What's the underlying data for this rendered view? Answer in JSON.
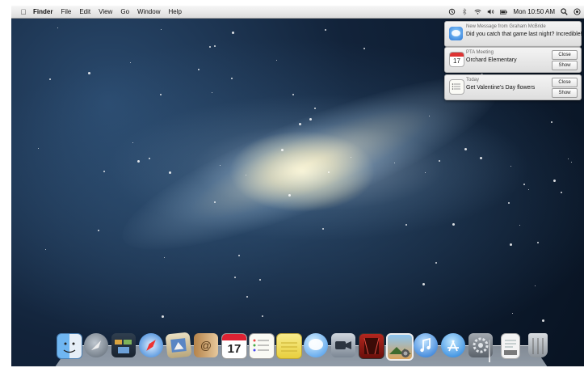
{
  "menubar": {
    "apple_glyph": "",
    "app_name": "Finder",
    "menus": [
      "File",
      "Edit",
      "View",
      "Go",
      "Window",
      "Help"
    ],
    "clock": "Mon 10:50 AM"
  },
  "notifications": [
    {
      "title": "New Message from Graham McBride",
      "body": "Did you catch that game last night? Incredible!",
      "icon": "messages-icon"
    },
    {
      "title": "PTA Meeting",
      "body": "Orchard Elementary",
      "icon": "calendar-icon",
      "calendar_day": "17",
      "buttons": [
        "Close",
        "Show"
      ]
    },
    {
      "title": "Today",
      "body": "Get Valentine's Day flowers",
      "icon": "reminders-icon",
      "buttons": [
        "Close",
        "Show"
      ]
    }
  ],
  "dock": {
    "calendar_day": "17",
    "items": [
      "Finder",
      "Launchpad",
      "Mission Control",
      "Safari",
      "Mail",
      "Contacts",
      "Calendar",
      "Reminders",
      "Notes",
      "Messages",
      "FaceTime",
      "Photo Booth",
      "iPhoto",
      "iTunes",
      "App Store",
      "System Preferences",
      "Document",
      "Trash"
    ]
  },
  "colors": {
    "menubar": "#e8e8e8",
    "accent": "#2f79d6"
  }
}
